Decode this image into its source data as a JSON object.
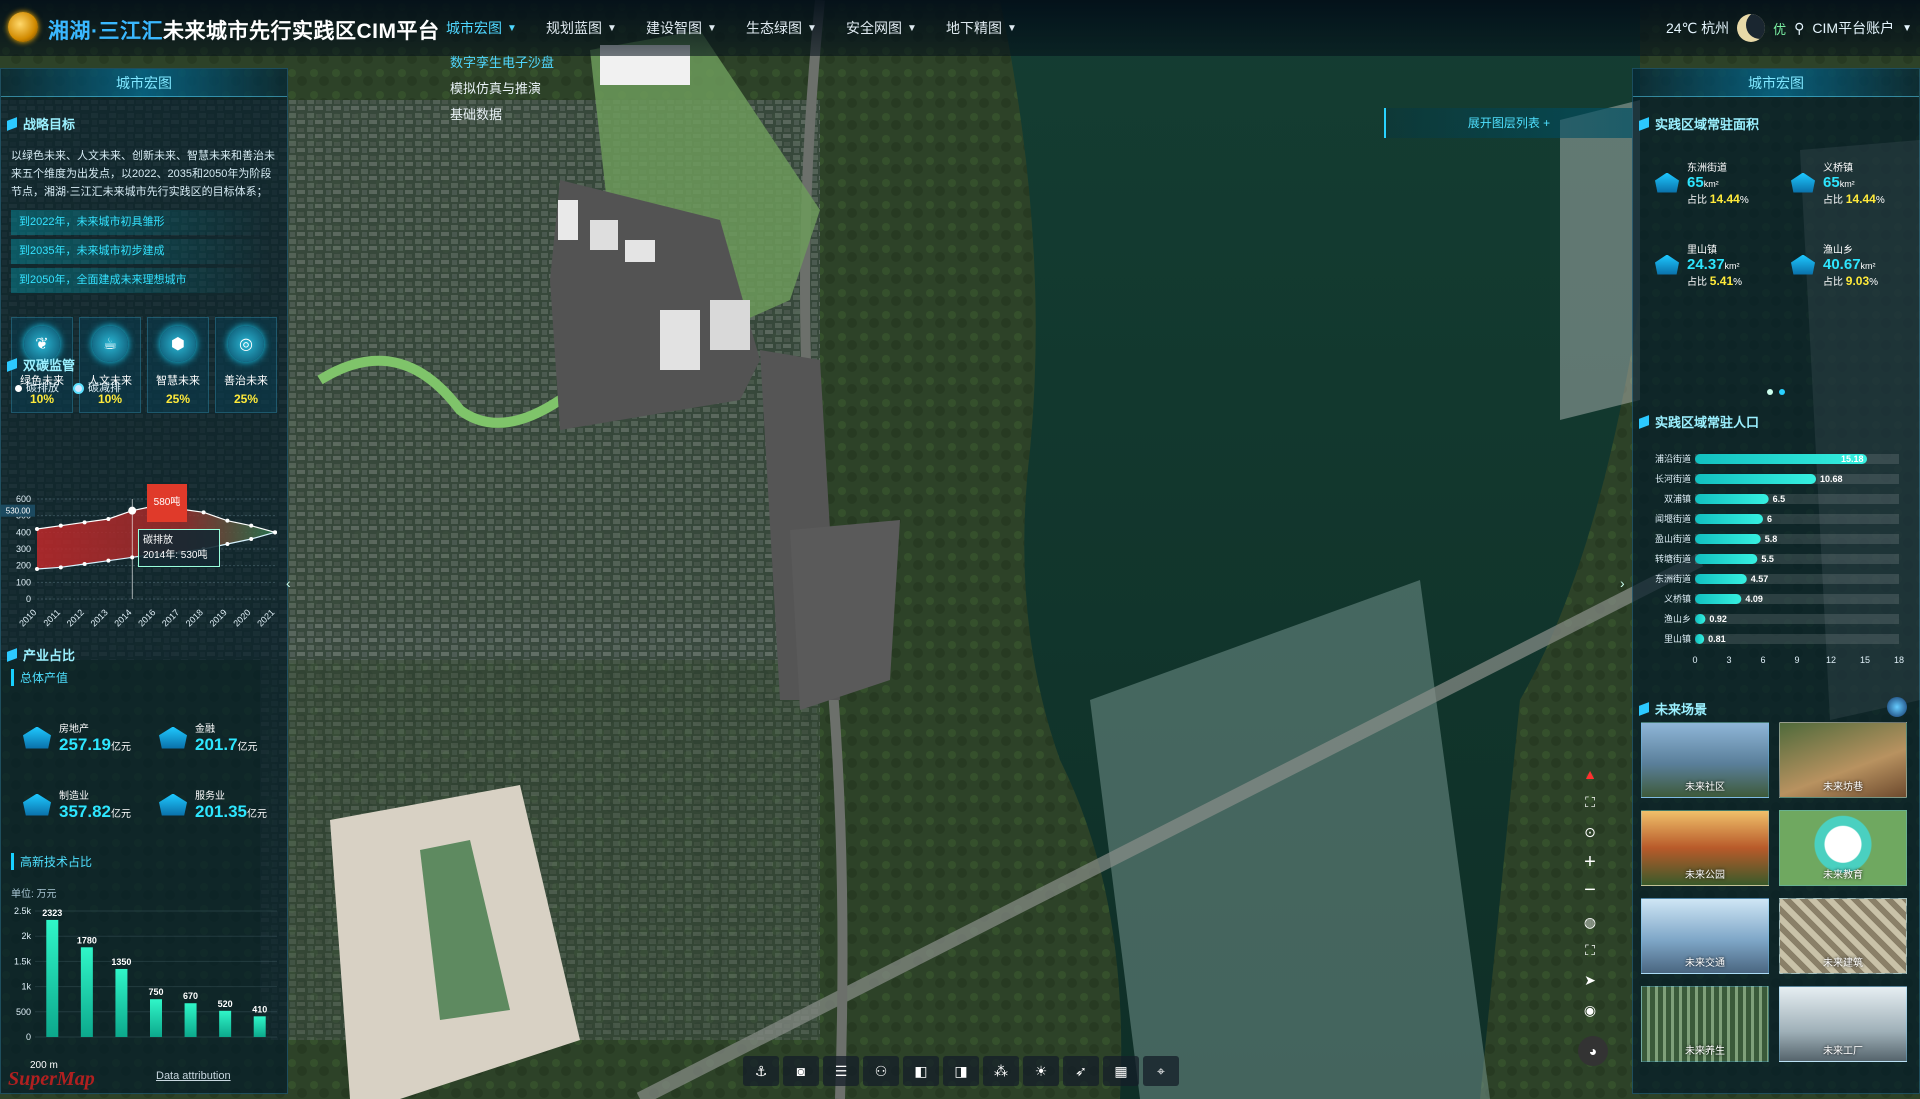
{
  "header": {
    "title_hl": "湘湖·三江汇",
    "title_rest": "未来城市先行实践区CIM平台",
    "nav": [
      {
        "label": "城市宏图"
      },
      {
        "label": "规划蓝图"
      },
      {
        "label": "建设智图"
      },
      {
        "label": "生态绿图"
      },
      {
        "label": "安全网图"
      },
      {
        "label": "地下精图"
      }
    ],
    "dropdown": [
      "数字孪生电子沙盘",
      "模拟仿真与推演",
      "基础数据"
    ],
    "weather": "24℃ 杭州",
    "air_quality": "优",
    "account": "CIM平台账户"
  },
  "left": {
    "panel_title": "城市宏图",
    "strategy": {
      "title": "战略目标",
      "text": "以绿色未来、人文未来、创新未来、智慧未来和善治未来五个维度为出发点，以2022、2035和2050年为阶段节点，湘湖·三江汇未来城市先行实践区的目标体系；",
      "goals": [
        "到2022年，未来城市初具雏形",
        "到2035年，未来城市初步建成",
        "到2050年，全面建成未来理想城市"
      ]
    },
    "futures": [
      {
        "label": "绿色未来",
        "pct": "10%"
      },
      {
        "label": "人文未来",
        "pct": "10%"
      },
      {
        "label": "智慧未来",
        "pct": "25%"
      },
      {
        "label": "善治未来",
        "pct": "25%"
      }
    ],
    "carbon": {
      "title": "双碳监管",
      "legend": [
        "碳排放",
        "碳减排"
      ],
      "flag": "580吨",
      "tooltip_name": "碳排放",
      "tooltip_value": "2014年: 530吨",
      "y_marker": "530.00"
    },
    "industry": {
      "title": "产业占比",
      "subtitle": "总体产值",
      "items": [
        {
          "name": "房地产",
          "value": "257.19",
          "unit": "亿元"
        },
        {
          "name": "金融",
          "value": "201.7",
          "unit": "亿元"
        },
        {
          "name": "制造业",
          "value": "357.82",
          "unit": "亿元"
        },
        {
          "name": "服务业",
          "value": "201.35",
          "unit": "亿元"
        }
      ]
    },
    "hitech": {
      "subtitle": "高新技术占比",
      "unit_label": "单位: 万元"
    }
  },
  "right": {
    "panel_title": "城市宏图",
    "area_title": "实践区域常驻面积",
    "areas": [
      {
        "name": "东洲街道",
        "value": "65",
        "unit": "km²",
        "pct_label": "占比",
        "pct": "14.44",
        "pct_unit": "%"
      },
      {
        "name": "义桥镇",
        "value": "65",
        "unit": "km²",
        "pct_label": "占比",
        "pct": "14.44",
        "pct_unit": "%"
      },
      {
        "name": "里山镇",
        "value": "24.37",
        "unit": "km²",
        "pct_label": "占比",
        "pct": "5.41",
        "pct_unit": "%"
      },
      {
        "name": "渔山乡",
        "value": "40.67",
        "unit": "km²",
        "pct_label": "占比",
        "pct": "9.03",
        "pct_unit": "%"
      }
    ],
    "pop_title": "实践区域常驻人口",
    "scenes_title": "未来场景",
    "scenes": [
      "未来社区",
      "未来坊巷",
      "未来公园",
      "未来教育",
      "未来交通",
      "未来建筑",
      "未来养生",
      "未来工厂"
    ]
  },
  "map": {
    "layer_button": "展开图层列表",
    "scale": "200 m",
    "attribution": "Data attribution",
    "watermark": "SuperMap"
  },
  "chart_data": [
    {
      "type": "area",
      "title": "双碳监管",
      "x": [
        "2010",
        "2011",
        "2012",
        "2013",
        "2014",
        "2016",
        "2017",
        "2018",
        "2019",
        "2020",
        "2021"
      ],
      "ylim": [
        0,
        600
      ],
      "yticks": [
        0,
        100,
        200,
        300,
        400,
        500,
        600
      ],
      "series": [
        {
          "name": "碳排放",
          "values": [
            420,
            440,
            460,
            480,
            530,
            560,
            540,
            520,
            470,
            440,
            400
          ]
        },
        {
          "name": "碳减排",
          "values": [
            180,
            190,
            210,
            230,
            250,
            270,
            280,
            300,
            330,
            360,
            400
          ]
        }
      ],
      "legend": "top-left"
    },
    {
      "type": "bar",
      "title": "高新技术占比",
      "categories": [
        "",
        "",
        "",
        "",
        "",
        "",
        ""
      ],
      "values": [
        2323,
        1780,
        1350,
        750,
        670,
        520,
        410
      ],
      "ylim": [
        0,
        2500
      ],
      "ytick_labels": [
        "0",
        "500",
        "1k",
        "1.5k",
        "2k",
        "2.5k"
      ],
      "ylabel": "单位: 万元"
    },
    {
      "type": "bar",
      "title": "实践区域常驻人口",
      "orientation": "horizontal",
      "categories": [
        "浦沿街道",
        "长河街道",
        "双浦镇",
        "闻堰街道",
        "盈山街道",
        "转塘街道",
        "东洲街道",
        "义桥镇",
        "渔山乡",
        "里山镇"
      ],
      "values": [
        15.18,
        10.68,
        6.5,
        6,
        5.8,
        5.5,
        4.57,
        4.09,
        0.92,
        0.81
      ],
      "xlim": [
        0,
        18
      ],
      "xticks": [
        0,
        3,
        6,
        9,
        12,
        15,
        18
      ]
    }
  ]
}
